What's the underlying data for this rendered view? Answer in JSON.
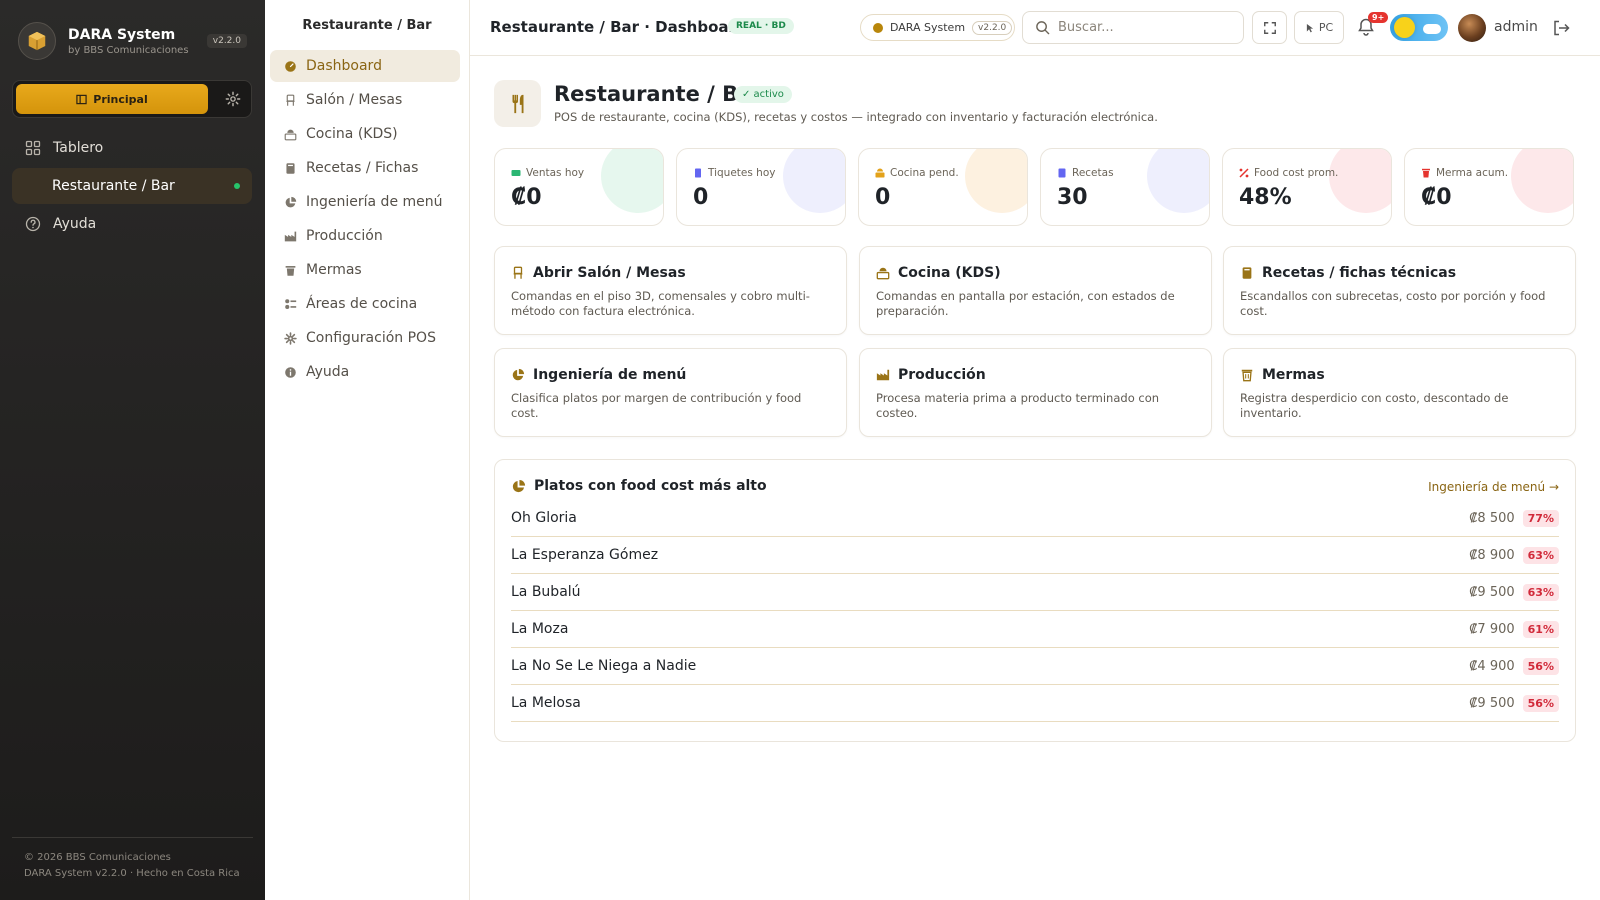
{
  "brand": {
    "name": "DARA System",
    "sub": "by BBS Comunicaciones",
    "version": "v2.2.0"
  },
  "mode": {
    "label": "Principal"
  },
  "sidebar": {
    "items": [
      {
        "label": "Tablero",
        "icon": "grid-icon"
      },
      {
        "label": "Restaurante / Bar",
        "icon": "",
        "active": true
      },
      {
        "label": "Ayuda",
        "icon": "help-icon"
      }
    ],
    "footer": {
      "line1": "© 2026 BBS Comunicaciones",
      "line2": "DARA System v2.2.0 · Hecho en Costa Rica"
    }
  },
  "subnav": {
    "title": "Restaurante / Bar",
    "items": [
      {
        "label": "Dashboard",
        "icon": "dashboard-icon",
        "active": true
      },
      {
        "label": "Salón / Mesas",
        "icon": "chair-icon"
      },
      {
        "label": "Cocina (KDS)",
        "icon": "kitchen-icon"
      },
      {
        "label": "Recetas / Fichas",
        "icon": "book-icon"
      },
      {
        "label": "Ingeniería de menú",
        "icon": "pie-icon"
      },
      {
        "label": "Producción",
        "icon": "factory-icon"
      },
      {
        "label": "Mermas",
        "icon": "trash-icon"
      },
      {
        "label": "Áreas de cocina",
        "icon": "areas-icon"
      },
      {
        "label": "Configuración POS",
        "icon": "gear-icon"
      },
      {
        "label": "Ayuda",
        "icon": "info-icon"
      }
    ]
  },
  "topbar": {
    "title": "Restaurante / Bar · Dashboard",
    "badge": "REAL · BD",
    "system_chip": "DARA System",
    "system_version": "v2.2.0",
    "search_placeholder": "Buscar...",
    "pc_label": "PC",
    "notif_count": "9+",
    "user": "admin"
  },
  "hero": {
    "title": "Restaurante / Bar",
    "badge": "✓ activo",
    "description": "POS de restaurante, cocina (KDS), recetas y costos — integrado con inventario y facturación electrónica."
  },
  "kpis": [
    {
      "label": "Ventas hoy",
      "value": "₡0",
      "color": "#2bb673",
      "blob": "#e6f7ee"
    },
    {
      "label": "Tiquetes hoy",
      "value": "0",
      "color": "#6366f1",
      "blob": "#eeeffd"
    },
    {
      "label": "Cocina pend.",
      "value": "0",
      "color": "#e3a21a",
      "blob": "#fdf1e0"
    },
    {
      "label": "Recetas",
      "value": "30",
      "color": "#6366f1",
      "blob": "#eeeffd"
    },
    {
      "label": "Food cost prom.",
      "value": "48%",
      "color": "#e5342f",
      "blob": "#fde8ea"
    },
    {
      "label": "Merma acum.",
      "value": "₡0",
      "color": "#e5342f",
      "blob": "#fde8ea"
    }
  ],
  "actions": [
    {
      "title": "Abrir Salón / Mesas",
      "icon": "chair-icon",
      "desc": "Comandas en el piso 3D, comensales y cobro multi-método con factura electrónica."
    },
    {
      "title": "Cocina (KDS)",
      "icon": "kitchen-icon",
      "desc": "Comandas en pantalla por estación, con estados de preparación."
    },
    {
      "title": "Recetas / fichas técnicas",
      "icon": "book-icon",
      "desc": "Escandallos con subrecetas, costo por porción y food cost."
    },
    {
      "title": "Ingeniería de menú",
      "icon": "pie-icon",
      "desc": "Clasifica platos por margen de contribución y food cost."
    },
    {
      "title": "Producción",
      "icon": "factory-icon",
      "desc": "Procesa materia prima a producto terminado con costeo."
    },
    {
      "title": "Mermas",
      "icon": "trash-icon",
      "desc": "Registra desperdicio con costo, descontado de inventario."
    }
  ],
  "foodcost": {
    "title": "Platos con food cost más alto",
    "link": "Ingeniería de menú →",
    "rows": [
      {
        "name": "Oh Gloria",
        "price": "₡8 500",
        "pct": "77%"
      },
      {
        "name": "La Esperanza Gómez",
        "price": "₡8 900",
        "pct": "63%"
      },
      {
        "name": "La Bubalú",
        "price": "₡9 500",
        "pct": "63%"
      },
      {
        "name": "La Moza",
        "price": "₡7 900",
        "pct": "61%"
      },
      {
        "name": "La No Se Le Niega a Nadie",
        "price": "₡4 900",
        "pct": "56%"
      },
      {
        "name": "La Melosa",
        "price": "₡9 500",
        "pct": "56%"
      }
    ]
  }
}
